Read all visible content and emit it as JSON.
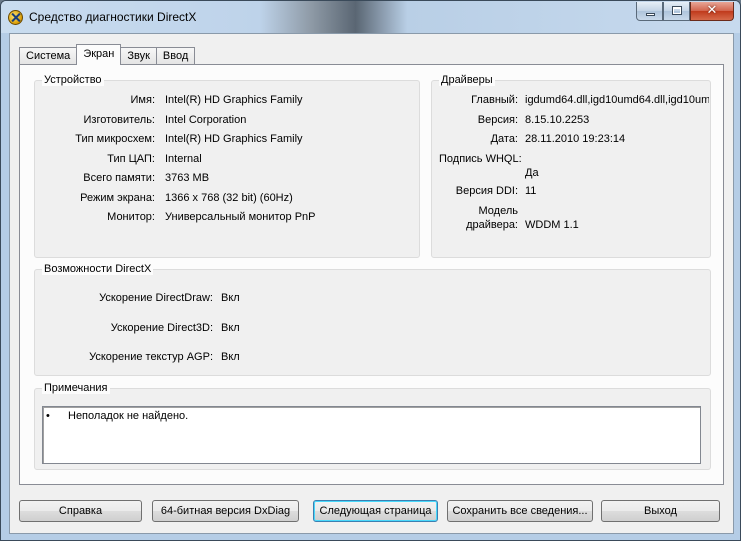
{
  "window": {
    "title": "Средство диагностики DirectX",
    "colors": {
      "client_bg": "#f0f0f0",
      "default_button_border": "#3c7fb1",
      "close_button": "#c03a1c"
    }
  },
  "icons": {
    "app": "directx-icon",
    "minimize": "minimize-icon",
    "maximize": "maximize-icon",
    "close": "close-icon",
    "close_glyph": "✕"
  },
  "tabs": [
    {
      "label": "Система",
      "active": false
    },
    {
      "label": "Экран",
      "active": true
    },
    {
      "label": "Звук",
      "active": false
    },
    {
      "label": "Ввод",
      "active": false
    }
  ],
  "device": {
    "title": "Устройство",
    "rows": [
      {
        "label": "Имя:",
        "value": "Intel(R) HD Graphics Family"
      },
      {
        "label": "Изготовитель:",
        "value": "Intel Corporation"
      },
      {
        "label": "Тип микросхем:",
        "value": "Intel(R) HD Graphics Family"
      },
      {
        "label": "Тип ЦАП:",
        "value": "Internal"
      },
      {
        "label": "Всего памяти:",
        "value": "3763 MB"
      },
      {
        "label": "Режим экрана:",
        "value": "1366 x 768 (32 bit) (60Hz)"
      },
      {
        "label": "Монитор:",
        "value": "Универсальный монитор PnP"
      }
    ]
  },
  "drivers": {
    "title": "Драйверы",
    "main_label": "Главный:",
    "main_value": "igdumd64.dll,igd10umd64.dll,igd10um",
    "version_label": "Версия:",
    "version_value": "8.15.10.2253",
    "date_label": "Дата:",
    "date_value": "28.11.2010 19:23:14",
    "whql_label": "Подпись WHQL:",
    "whql_value": "Да",
    "ddi_label": "Версия DDI:",
    "ddi_value": "11",
    "model_label_1": "Модель",
    "model_label_2": "драйвера:",
    "model_value": "WDDM 1.1"
  },
  "directx": {
    "title": "Возможности DirectX",
    "rows": [
      {
        "label": "Ускорение DirectDraw:",
        "value": "Вкл"
      },
      {
        "label": "Ускорение Direct3D:",
        "value": "Вкл"
      },
      {
        "label": "Ускорение текстур AGP:",
        "value": "Вкл"
      }
    ]
  },
  "notes": {
    "title": "Примечания",
    "bullet": "•",
    "items": [
      "Неполадок не найдено."
    ]
  },
  "buttons": {
    "help": "Справка",
    "dxdiag64": "64-битная версия DxDiag",
    "next_page": "Следующая страница",
    "save_all": "Сохранить все сведения...",
    "exit": "Выход"
  }
}
